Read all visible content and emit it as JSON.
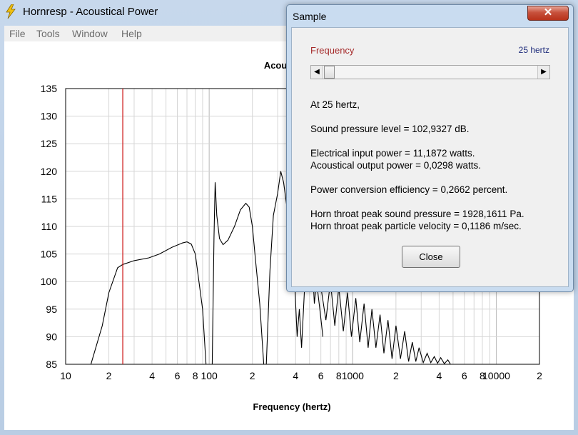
{
  "window": {
    "title": "Hornresp - Acoustical Power"
  },
  "menu": [
    "File",
    "Tools",
    "Window",
    "Help"
  ],
  "chart_data": {
    "type": "line",
    "title": "Acoustical Power",
    "xlabel": "Frequency (hertz)",
    "xscale": "log",
    "xlim": [
      10,
      20000
    ],
    "ylim": [
      85,
      135
    ],
    "y_ticks": [
      85,
      90,
      95,
      100,
      105,
      110,
      115,
      120,
      125,
      130,
      135
    ],
    "x_ticks": [
      {
        "v": 10,
        "label": "10"
      },
      {
        "v": 20,
        "label": "2"
      },
      {
        "v": 40,
        "label": "4"
      },
      {
        "v": 60,
        "label": "6"
      },
      {
        "v": 80,
        "label": "8"
      },
      {
        "v": 100,
        "label": "100"
      },
      {
        "v": 200,
        "label": "2"
      },
      {
        "v": 400,
        "label": "4"
      },
      {
        "v": 600,
        "label": "6"
      },
      {
        "v": 800,
        "label": "8"
      },
      {
        "v": 1000,
        "label": "1000"
      },
      {
        "v": 2000,
        "label": "2"
      },
      {
        "v": 4000,
        "label": "4"
      },
      {
        "v": 6000,
        "label": "6"
      },
      {
        "v": 8000,
        "label": "8"
      },
      {
        "v": 10000,
        "label": "10000"
      },
      {
        "v": 20000,
        "label": "2"
      }
    ],
    "grid": true,
    "marker_frequency": 25,
    "series": [
      {
        "points": [
          [
            15,
            85
          ],
          [
            18,
            92
          ],
          [
            20,
            98
          ],
          [
            23,
            102.5
          ],
          [
            25,
            103.1
          ],
          [
            30,
            103.8
          ],
          [
            38,
            104.3
          ],
          [
            45,
            105
          ],
          [
            55,
            106.2
          ],
          [
            65,
            107
          ],
          [
            70,
            107.2
          ],
          [
            75,
            106.8
          ],
          [
            80,
            105
          ],
          [
            90,
            95
          ],
          [
            95,
            85
          ],
          [
            105,
            85
          ],
          [
            108,
            108
          ],
          [
            110,
            118
          ],
          [
            113,
            112
          ],
          [
            118,
            107.8
          ],
          [
            125,
            106.7
          ],
          [
            135,
            107.5
          ],
          [
            150,
            110
          ],
          [
            165,
            113
          ],
          [
            180,
            114.2
          ],
          [
            190,
            113.5
          ],
          [
            200,
            110
          ],
          [
            210,
            104
          ],
          [
            225,
            96
          ],
          [
            240,
            85
          ],
          [
            250,
            85
          ],
          [
            265,
            102
          ],
          [
            280,
            112
          ],
          [
            300,
            116
          ],
          [
            315,
            120
          ],
          [
            330,
            118
          ],
          [
            350,
            113
          ],
          [
            375,
            109
          ],
          [
            385,
            106
          ],
          [
            400,
            96
          ],
          [
            410,
            90
          ],
          [
            425,
            95
          ],
          [
            440,
            88
          ],
          [
            460,
            98
          ],
          [
            480,
            110
          ],
          [
            500,
            115
          ],
          [
            520,
            105
          ],
          [
            540,
            96
          ],
          [
            560,
            100
          ],
          [
            590,
            95
          ],
          [
            620,
            90
          ]
        ]
      },
      {
        "points": [
          [
            600,
            99
          ],
          [
            650,
            93
          ],
          [
            700,
            100
          ],
          [
            750,
            92
          ],
          [
            800,
            99
          ],
          [
            860,
            91
          ],
          [
            920,
            98
          ],
          [
            980,
            90
          ],
          [
            1050,
            97
          ],
          [
            1120,
            89
          ],
          [
            1200,
            96
          ],
          [
            1280,
            88
          ],
          [
            1360,
            95
          ],
          [
            1450,
            88
          ],
          [
            1550,
            94
          ],
          [
            1650,
            87
          ],
          [
            1760,
            93
          ],
          [
            1880,
            86
          ],
          [
            2000,
            92
          ],
          [
            2150,
            86
          ],
          [
            2300,
            91
          ],
          [
            2450,
            85.5
          ],
          [
            2600,
            89
          ],
          [
            2750,
            85.5
          ],
          [
            2900,
            88
          ],
          [
            3100,
            85.3
          ],
          [
            3300,
            87
          ],
          [
            3500,
            85.3
          ],
          [
            3700,
            86.4
          ],
          [
            3900,
            85.2
          ],
          [
            4100,
            86.2
          ],
          [
            4350,
            85.1
          ],
          [
            4600,
            85.8
          ],
          [
            4800,
            85
          ]
        ]
      }
    ]
  },
  "sample": {
    "title": "Sample",
    "close_glyph": "✕",
    "slider_label": "Frequency",
    "slider_value": "25 hertz",
    "slider_fraction": 0.0,
    "lines": [
      "At 25 hertz,",
      "Sound pressure level = 102,9327 dB.",
      "Electrical input power = 11,1872 watts.",
      "Acoustical output power = 0,0298 watts.",
      "Power conversion efficiency = 0,2662 percent.",
      "Horn throat peak sound pressure = 1928,1611 Pa.",
      "Horn throat peak particle velocity = 0,1186 m/sec."
    ],
    "close_label": "Close"
  }
}
